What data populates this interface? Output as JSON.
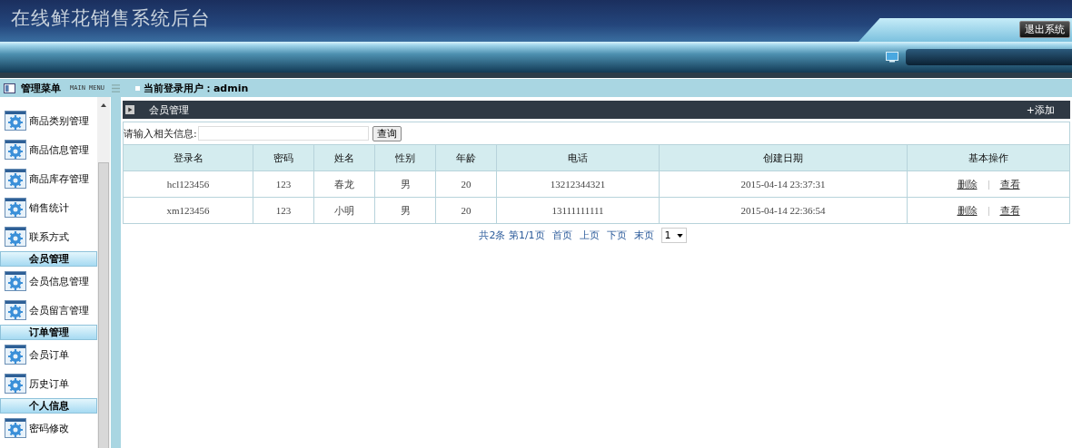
{
  "header": {
    "title": "在线鲜花销售系统后台",
    "logout_button": "退出系统"
  },
  "menu_bar": {
    "title": "管理菜单",
    "subtitle": "MAIN MENU",
    "user_label": "当前登录用户：",
    "user": "admin"
  },
  "sidebar": {
    "items": [
      {
        "kind": "item",
        "label": "商品类别管理"
      },
      {
        "kind": "item",
        "label": "商品信息管理"
      },
      {
        "kind": "item",
        "label": "商品库存管理"
      },
      {
        "kind": "item",
        "label": "销售统计"
      },
      {
        "kind": "item",
        "label": "联系方式"
      },
      {
        "kind": "section",
        "label": "会员管理"
      },
      {
        "kind": "item",
        "label": "会员信息管理"
      },
      {
        "kind": "item",
        "label": "会员留言管理"
      },
      {
        "kind": "section",
        "label": "订单管理"
      },
      {
        "kind": "item",
        "label": "会员订单"
      },
      {
        "kind": "item",
        "label": "历史订单"
      },
      {
        "kind": "section",
        "label": "个人信息"
      },
      {
        "kind": "item",
        "label": "密码修改"
      }
    ]
  },
  "panel": {
    "title": "会员管理",
    "add_button": "+添加",
    "search": {
      "label": "请输入相关信息:",
      "button": "查询"
    },
    "table": {
      "columns": [
        "登录名",
        "密码",
        "姓名",
        "性别",
        "年龄",
        "电话",
        "创建日期",
        "基本操作"
      ],
      "rows": [
        {
          "cells": [
            "hcl123456",
            "123",
            "春龙",
            "男",
            "20",
            "13212344321",
            "2015-04-14 23:37:31"
          ],
          "actions": [
            "删除",
            "查看"
          ]
        },
        {
          "cells": [
            "xm123456",
            "123",
            "小明",
            "男",
            "20",
            "13111111111",
            "2015-04-14 22:36:54"
          ],
          "actions": [
            "删除",
            "查看"
          ]
        }
      ]
    },
    "pagination": {
      "summary": "共2条 第1/1页",
      "links": [
        "首页",
        "上页",
        "下页",
        "末页"
      ],
      "page": "1"
    }
  }
}
